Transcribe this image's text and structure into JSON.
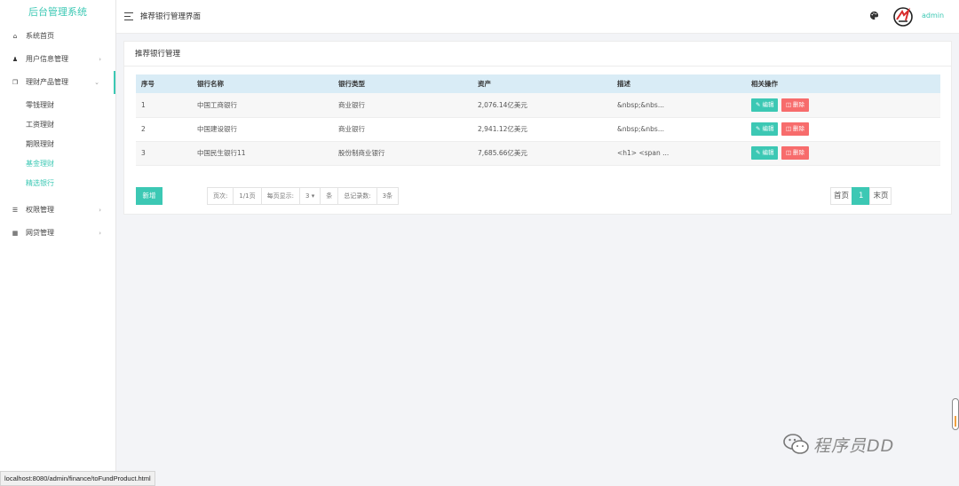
{
  "sidebar": {
    "brand": "后台管理系统",
    "items": [
      {
        "label": "系统首页",
        "icon": "home-icon"
      },
      {
        "label": "用户信息管理",
        "icon": "users-icon"
      },
      {
        "label": "理财产品管理",
        "icon": "copy-icon"
      },
      {
        "label": "权限管理",
        "icon": "sliders-icon"
      },
      {
        "label": "网贷管理",
        "icon": "card-icon"
      }
    ],
    "sub_items": [
      "零钱理财",
      "工资理财",
      "期限理财",
      "基金理财",
      "精选银行"
    ]
  },
  "header": {
    "title": "推荐银行管理界面",
    "username": "admin",
    "accent": "#3cc8b4"
  },
  "panel": {
    "title": "推荐银行管理"
  },
  "table": {
    "columns": [
      "序号",
      "银行名称",
      "银行类型",
      "资产",
      "描述",
      "相关操作"
    ],
    "rows": [
      {
        "id": "1",
        "name": "中国工商银行",
        "type": "商业银行",
        "assets": "2,076.14亿美元",
        "desc": "&nbsp;&nbs..."
      },
      {
        "id": "2",
        "name": "中国建设银行",
        "type": "商业银行",
        "assets": "2,941.12亿美元",
        "desc": "&nbsp;&nbs..."
      },
      {
        "id": "3",
        "name": "中国民生银行11",
        "type": "股份制商业银行",
        "assets": "7,685.66亿美元",
        "desc": "<h1> <span ..."
      }
    ],
    "edit_label": "编辑",
    "delete_label": "删除"
  },
  "footer": {
    "add_label": "新增",
    "page_label": "页次:",
    "page_value": "1/1页",
    "per_page_label": "每页显示:",
    "per_page_value": "3",
    "per_page_unit": "条",
    "total_label": "总记录数:",
    "total_value": "3条",
    "first_label": "首页",
    "current_page": "1",
    "last_label": "末页"
  },
  "statusbar": {
    "url": "localhost:8080/admin/finance/toFundProduct.html"
  },
  "watermark": {
    "text": "程序员DD"
  }
}
